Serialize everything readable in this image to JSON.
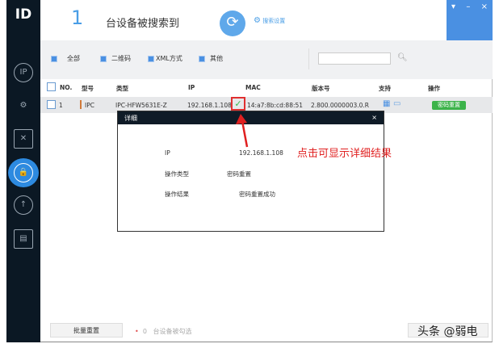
{
  "app": {
    "logo": "ID"
  },
  "header": {
    "count": "1",
    "found_label": "台设备被搜索到",
    "search_settings": "搜索设置",
    "window_controls": [
      "▾",
      "–",
      "×"
    ]
  },
  "filters": [
    {
      "label": "全部"
    },
    {
      "label": "二维码"
    },
    {
      "label": "XML方式"
    },
    {
      "label": "其他"
    }
  ],
  "search": {
    "placeholder": ""
  },
  "table": {
    "headers": [
      "NO.",
      "型号",
      "类型",
      "IP",
      "MAC",
      "版本号",
      "支持",
      "操作"
    ],
    "rows": [
      {
        "no": "1",
        "model": "IPC",
        "type": "IPC-HFW5631E-Z",
        "ip": "192.168.1.108",
        "mac": "14:a7:8b:cd:88:51",
        "version": "2.800.0000003.0.R",
        "action": "密码重置"
      }
    ]
  },
  "dialog": {
    "title": "详细",
    "close": "×",
    "fields": [
      {
        "label": "IP",
        "value": "192.168.1.108"
      },
      {
        "label": "操作类型",
        "value": "密码重置"
      },
      {
        "label": "操作结果",
        "value": "密码重置成功"
      }
    ]
  },
  "annotation": "点击可显示详细结果",
  "footer": {
    "batch_button": "批量重置",
    "selected_count": "0",
    "selected_label": "台设备被勾选"
  },
  "watermark": "头条 @弱电",
  "colors": {
    "accent": "#4a90e2",
    "sidebar": "#0b1824",
    "success": "#3cb34a",
    "annotation": "#e02020"
  }
}
